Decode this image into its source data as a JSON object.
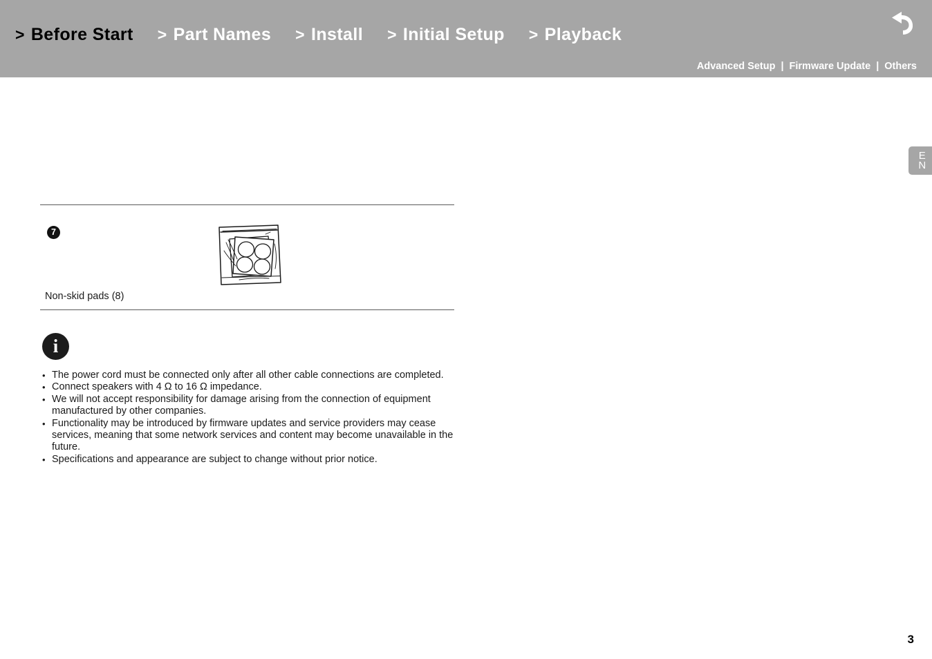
{
  "header": {
    "background_color": "#a6a6a6",
    "nav_items": [
      {
        "chevron": ">",
        "label": "Before Start",
        "active": true
      },
      {
        "chevron": ">",
        "label": "Part Names",
        "active": false
      },
      {
        "chevron": ">",
        "label": "Install",
        "active": false
      },
      {
        "chevron": ">",
        "label": "Initial Setup",
        "active": false
      },
      {
        "chevron": ">",
        "label": "Playback",
        "active": false
      }
    ],
    "sub_nav": {
      "items": [
        {
          "label": "Advanced Setup"
        },
        {
          "label": "Firmware Update"
        },
        {
          "label": "Others"
        }
      ],
      "separator": "|"
    },
    "back_button": {
      "icon": "back-arrow-icon",
      "color": "#ffffff"
    }
  },
  "language_tab": {
    "line1": "E",
    "line2": "N",
    "background_color": "#a6a6a6",
    "text_color": "#ffffff"
  },
  "accessory": {
    "number": "7",
    "label": "Non-skid pads (8)",
    "illustration": "non-skid-pads-bag-illustration"
  },
  "note": {
    "icon": "info-icon",
    "icon_glyph": "i",
    "items": [
      "The power cord must be connected only after all other cable connections are completed.",
      "Connect speakers with 4 Ω to 16 Ω impedance.",
      "We will not accept responsibility for damage arising from the connection of equipment manufactured by other companies.",
      "Functionality may be introduced by firmware updates and service providers may cease services, meaning that some network services and content may become unavailable in the future.",
      "Specifications and appearance are subject to change without prior notice."
    ]
  },
  "footer": {
    "page_number": "3"
  }
}
